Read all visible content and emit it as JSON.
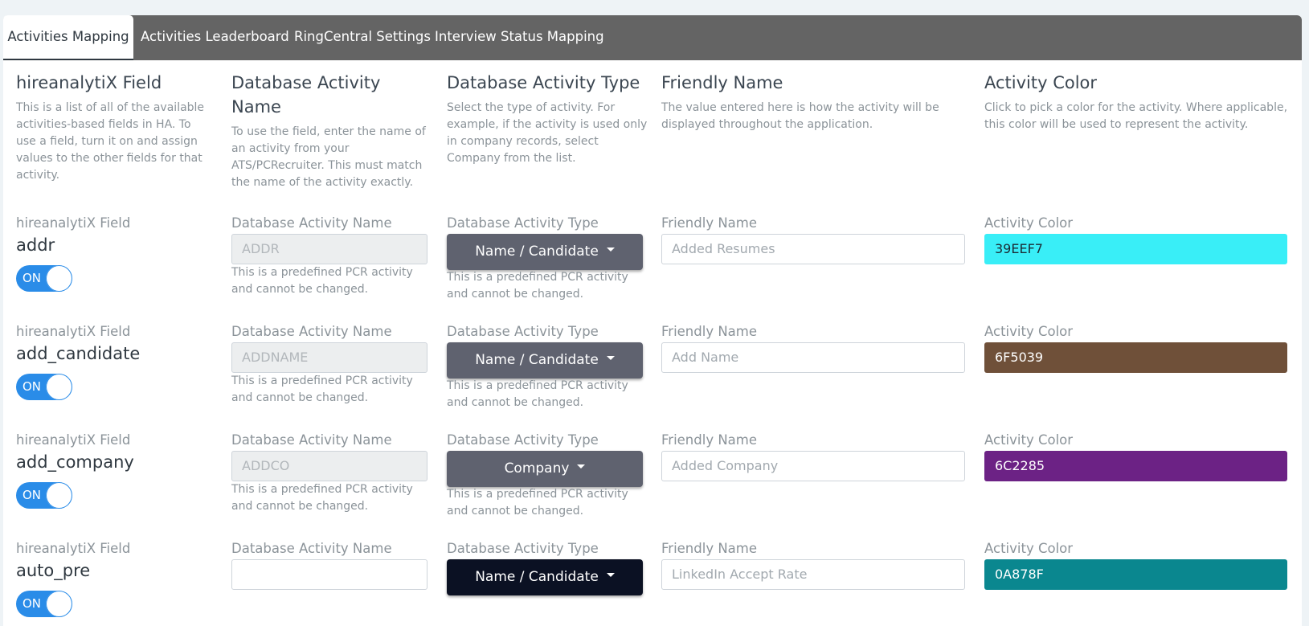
{
  "tabs": [
    {
      "label": "Activities Mapping",
      "active": true
    },
    {
      "label": "Activities Leaderboard",
      "active": false
    },
    {
      "label": "RingCentral Settings",
      "active": false
    },
    {
      "label": "Interview Status Mapping",
      "active": false
    }
  ],
  "headers": {
    "field": {
      "title": "hireanalytiX Field",
      "desc": "This is a list of all of the available activities-based fields in HA. To use a field, turn it on and assign values to the other fields for that activity."
    },
    "db_name": {
      "title": "Database Activity Name",
      "desc": "To use the field, enter the name of an activity from your ATS/PCRecruiter. This must match the name of the activity exactly."
    },
    "db_type": {
      "title": "Database Activity Type",
      "desc": "Select the type of activity. For example, if the activity is used only in company records, select Company from the list."
    },
    "friendly": {
      "title": "Friendly Name",
      "desc": "The value entered here is how the activity will be displayed throughout the application."
    },
    "color": {
      "title": "Activity Color",
      "desc": "Click to pick a color for the activity. Where applicable, this color will be used to represent the activity."
    }
  },
  "labels": {
    "field": "hireanalytiX Field",
    "db_name": "Database Activity Name",
    "db_type": "Database Activity Type",
    "friendly": "Friendly Name",
    "color": "Activity Color",
    "toggle_on": "ON",
    "predefined_help": "This is a predefined PCR activity and cannot be changed."
  },
  "rows": [
    {
      "field": "addr",
      "toggle": "on",
      "db_name": "ADDR",
      "db_name_disabled": true,
      "db_type": "Name / Candidate",
      "friendly_placeholder": "Added Resumes",
      "color_hex": "39EEF7",
      "color": "#39EEF7",
      "color_text": "#1b2a33"
    },
    {
      "field": "add_candidate",
      "toggle": "on",
      "db_name": "ADDNAME",
      "db_name_disabled": true,
      "db_type": "Name / Candidate",
      "friendly_placeholder": "Add Name",
      "color_hex": "6F5039",
      "color": "#6F5039",
      "color_text": "#ffffff"
    },
    {
      "field": "add_company",
      "toggle": "on",
      "db_name": "ADDCO",
      "db_name_disabled": true,
      "db_type": "Company",
      "friendly_placeholder": "Added Company",
      "color_hex": "6C2285",
      "color": "#6C2285",
      "color_text": "#ffffff"
    },
    {
      "field": "auto_pre",
      "toggle": "on",
      "db_name": "",
      "db_name_disabled": false,
      "db_type": "Name / Candidate",
      "friendly_placeholder": "LinkedIn Accept Rate",
      "color_hex": "0A878F",
      "color": "#0A878F",
      "color_text": "#ffffff"
    }
  ]
}
